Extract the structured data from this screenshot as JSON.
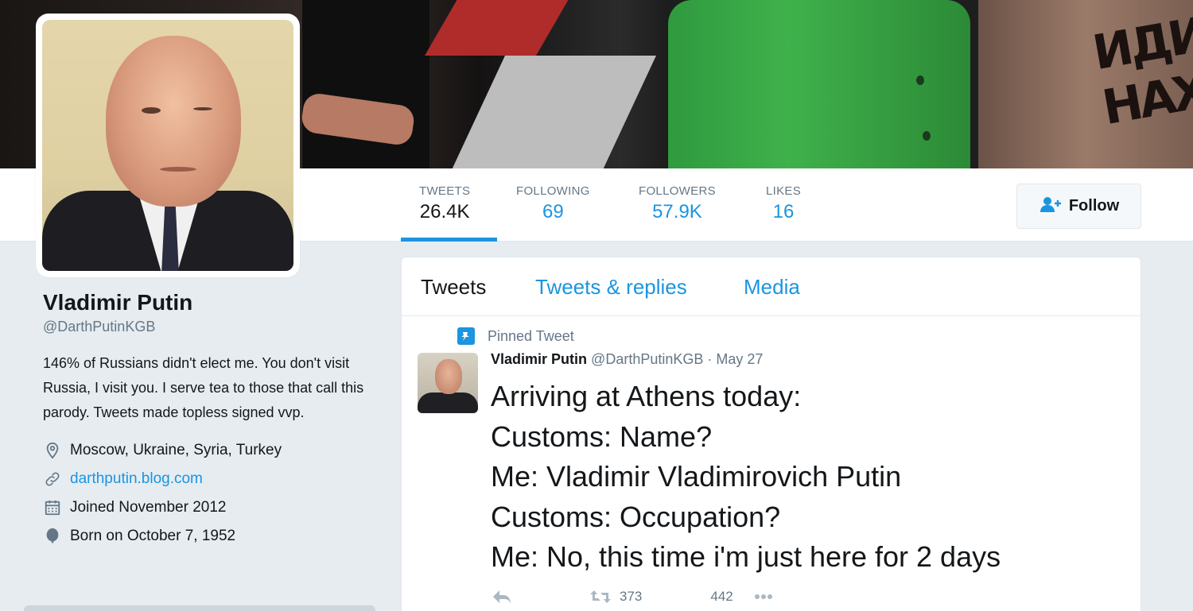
{
  "profile": {
    "name": "Vladimir Putin",
    "handle": "@DarthPutinKGB",
    "bio": "146% of Russians didn't elect me. You don't visit Russia, I visit you. I serve tea to those that call this parody. Tweets made topless signed vvp.",
    "location": "Moscow, Ukraine, Syria, Turkey",
    "website": "darthputin.blog.com",
    "joined": "Joined November 2012",
    "born": "Born on October 7, 1952"
  },
  "banner": {
    "graffiti": "ИДИ НАХ"
  },
  "stats": [
    {
      "label": "TWEETS",
      "value": "26.4K"
    },
    {
      "label": "FOLLOWING",
      "value": "69"
    },
    {
      "label": "FOLLOWERS",
      "value": "57.9K"
    },
    {
      "label": "LIKES",
      "value": "16"
    }
  ],
  "follow_button": {
    "label": "Follow"
  },
  "tabs": [
    "Tweets",
    "Tweets & replies",
    "Media"
  ],
  "pinned_tweet": {
    "context": "Pinned Tweet",
    "author_name": "Vladimir Putin",
    "author_handle": "@DarthPutinKGB",
    "separator": "·",
    "date": "May 27",
    "lines": [
      "Arriving at Athens today:",
      "Customs: Name?",
      "Me: Vladimir Vladimirovich Putin",
      "Customs: Occupation?",
      "Me: No, this time i'm just here for 2 days"
    ],
    "retweets": "373",
    "likes": "442"
  },
  "colors": {
    "accent": "#1b95e0",
    "muted": "#657786",
    "background": "#e6ecf0"
  }
}
